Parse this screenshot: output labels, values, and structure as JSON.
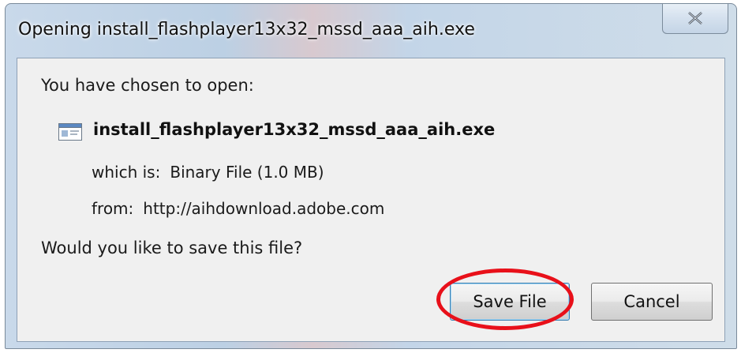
{
  "window": {
    "title": "Opening install_flashplayer13x32_mssd_aaa_aih.exe"
  },
  "titlebar": {
    "close_icon": "close-x-icon"
  },
  "dialog": {
    "prompt": "You have chosen to open:",
    "file_icon": "executable-file-icon",
    "file_name": "install_flashplayer13x32_mssd_aaa_aih.exe",
    "which_is_label": "which is:",
    "which_is_value": "Binary File (1.0 MB)",
    "from_label": "from:",
    "from_value": "http://aihdownload.adobe.com",
    "question": "Would you like to save this file?"
  },
  "buttons": {
    "save_label": "Save File",
    "cancel_label": "Cancel"
  },
  "annotation": {
    "highlight_color": "#e8101a"
  }
}
